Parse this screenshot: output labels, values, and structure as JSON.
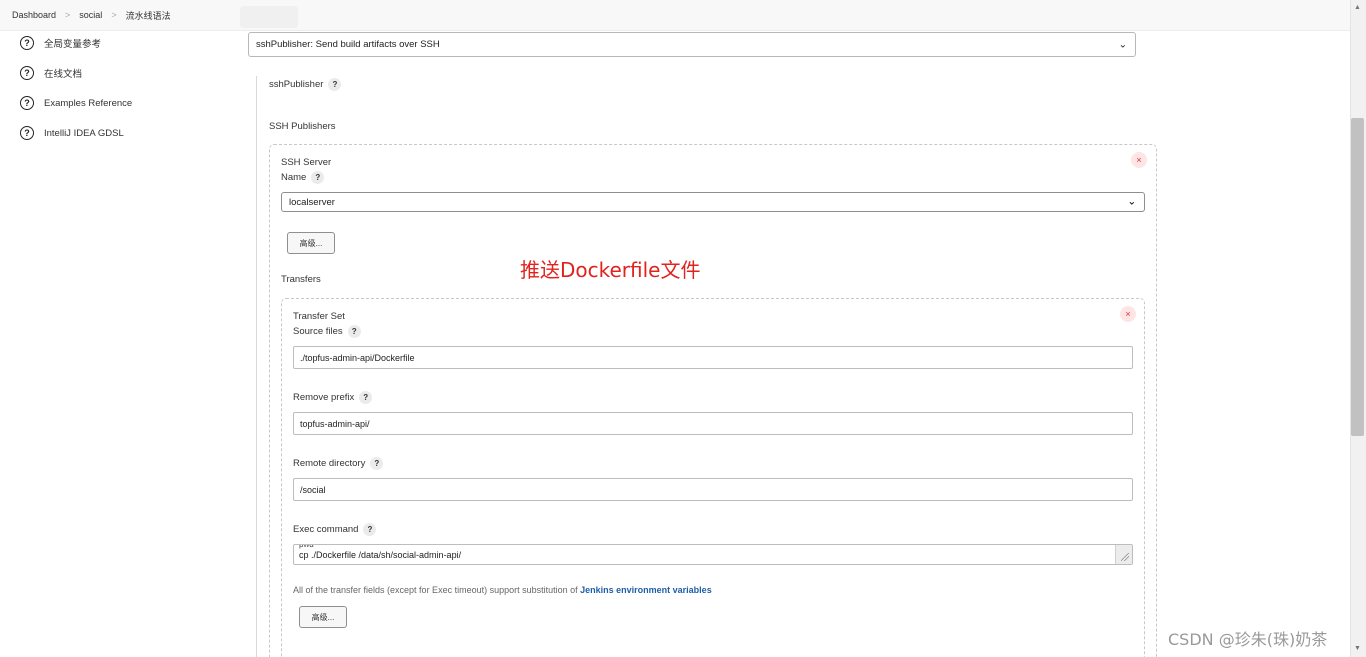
{
  "breadcrumb": {
    "items": [
      "Dashboard",
      "social",
      "流水线语法"
    ],
    "separator": ">"
  },
  "sidebar": {
    "items": [
      {
        "icon": "help-circle-icon",
        "label": "全局变量参考"
      },
      {
        "icon": "help-circle-icon",
        "label": "在线文档"
      },
      {
        "icon": "help-circle-icon",
        "label": "Examples Reference"
      },
      {
        "icon": "help-circle-icon",
        "label": "IntelliJ IDEA GDSL"
      }
    ]
  },
  "step": {
    "selected": "sshPublisher: Send build artifacts over SSH",
    "publisher_label": "sshPublisher",
    "help": "?",
    "publishers_heading": "SSH Publishers"
  },
  "ssh_server": {
    "heading": "SSH Server",
    "name_label": "Name",
    "name_value": "localserver",
    "advanced_button": "高级...",
    "close": "×",
    "transfers_heading": "Transfers"
  },
  "transfer_set": {
    "heading": "Transfer Set",
    "close": "×",
    "source_files_label": "Source files",
    "source_files_value": "./topfus-admin-api/Dockerfile",
    "remove_prefix_label": "Remove prefix",
    "remove_prefix_value": "topfus-admin-api/",
    "remote_directory_label": "Remote directory",
    "remote_directory_value": "/social",
    "exec_command_label": "Exec command",
    "exec_command_prev_line": "pwd",
    "exec_command_value": "cp ./Dockerfile /data/sh/social-admin-api/",
    "note_text": "All of the transfer fields (except for Exec timeout) support substitution of ",
    "note_link": "Jenkins environment variables",
    "advanced_button": "高级..."
  },
  "annotation": "推送Dockerfile文件",
  "watermark": "CSDN @珍朱(珠)奶茶",
  "colors": {
    "annotation": "#e0231e",
    "link": "#1f5fa8",
    "close_bg": "#fde5e5",
    "close_fg": "#d33"
  }
}
